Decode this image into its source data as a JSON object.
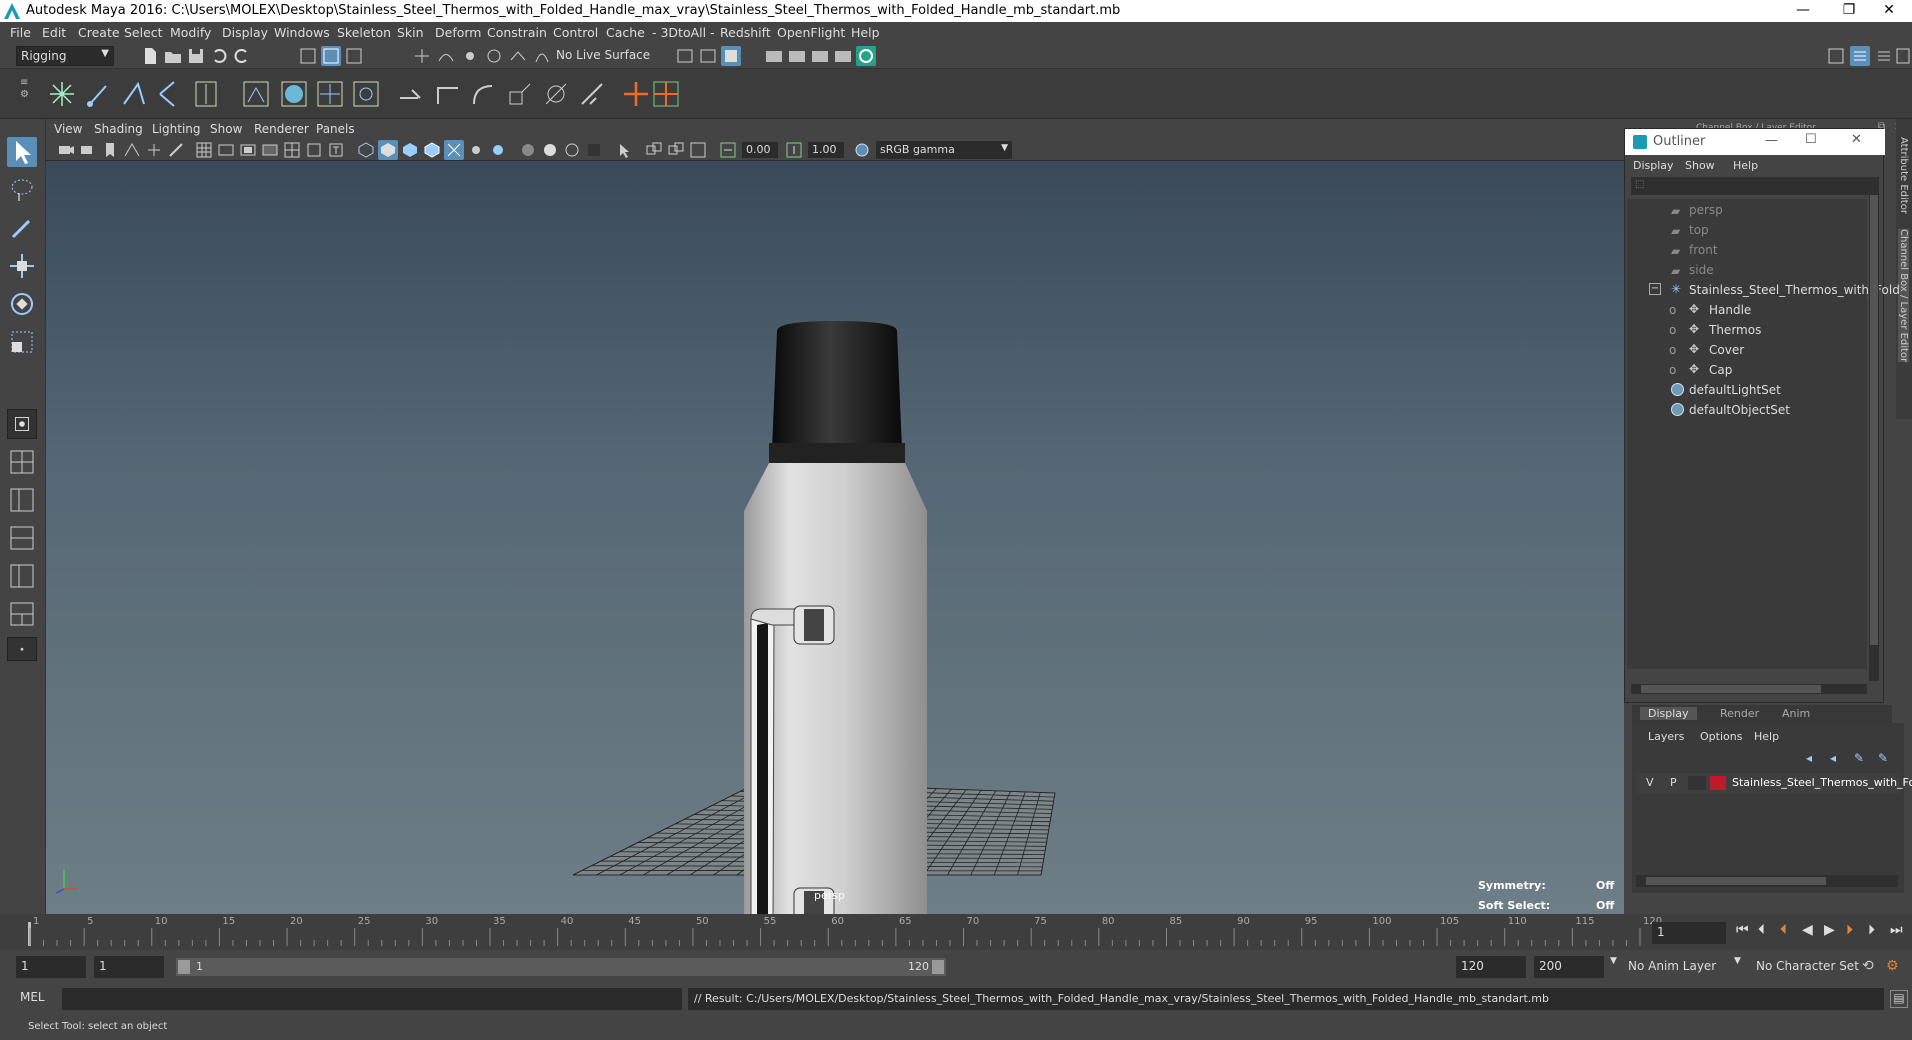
{
  "window": {
    "title": "Autodesk Maya 2016: C:\\Users\\MOLEX\\Desktop\\Stainless_Steel_Thermos_with_Folded_Handle_max_vray\\Stainless_Steel_Thermos_with_Folded_Handle_mb_standart.mb"
  },
  "menubar": [
    "File",
    "Edit",
    "Create",
    "Select",
    "Modify",
    "Display",
    "Windows",
    "Skeleton",
    "Skin",
    "Deform",
    "Constrain",
    "Control",
    "Cache",
    "- 3DtoAll -",
    "Redshift",
    "OpenFlight",
    "Help"
  ],
  "statusline": {
    "mode": "Rigging",
    "live_surface": "No Live Surface"
  },
  "viewport_menu": [
    "View",
    "Shading",
    "Lighting",
    "Show",
    "Renderer",
    "Panels"
  ],
  "viewport_toolbar": {
    "exposure": "0.00",
    "gamma": "1.00",
    "color_space": "sRGB gamma"
  },
  "viewport": {
    "camera_label": "persp",
    "symmetry_label": "Symmetry:",
    "symmetry_value": "Off",
    "soft_select_label": "Soft Select:",
    "soft_select_value": "Off"
  },
  "outliner": {
    "title": "Outliner",
    "menu": [
      "Display",
      "Show",
      "Help"
    ],
    "items": [
      {
        "label": "persp"
      },
      {
        "label": "top"
      },
      {
        "label": "front"
      },
      {
        "label": "side"
      },
      {
        "label": "Stainless_Steel_Thermos_with_Fold"
      },
      {
        "label": "Handle"
      },
      {
        "label": "Thermos"
      },
      {
        "label": "Cover"
      },
      {
        "label": "Cap"
      },
      {
        "label": "defaultLightSet"
      },
      {
        "label": "defaultObjectSet"
      }
    ]
  },
  "channel_box": {
    "header": "Channel Box / Layer Editor",
    "tabs": [
      "Display",
      "Render",
      "Anim"
    ],
    "menu": [
      "Layers",
      "Options",
      "Help"
    ],
    "layer": {
      "v": "V",
      "p": "P",
      "name": "Stainless_Steel_Thermos_with_Fo",
      "color": "#c0192c"
    }
  },
  "vertical_tabs": [
    "Attribute Editor",
    "Channel Box / Layer Editor"
  ],
  "timeline": {
    "ticks": [
      "1",
      "5",
      "10",
      "15",
      "20",
      "25",
      "30",
      "35",
      "40",
      "45",
      "50",
      "55",
      "60",
      "65",
      "70",
      "75",
      "80",
      "85",
      "90",
      "95",
      "100",
      "105",
      "110",
      "115",
      "120"
    ],
    "current_frame": "1"
  },
  "range": {
    "start": "1",
    "start2": "1",
    "slider_start": "1",
    "slider_end": "120",
    "end": "120",
    "end2": "200",
    "anim_layer": "No Anim Layer",
    "char_set": "No Character Set"
  },
  "cmdline": {
    "lang": "MEL",
    "result": "// Result: C:/Users/MOLEX/Desktop/Stainless_Steel_Thermos_with_Folded_Handle_max_vray/Stainless_Steel_Thermos_with_Folded_Handle_mb_standart.mb"
  },
  "helpline": "Select Tool: select an object"
}
